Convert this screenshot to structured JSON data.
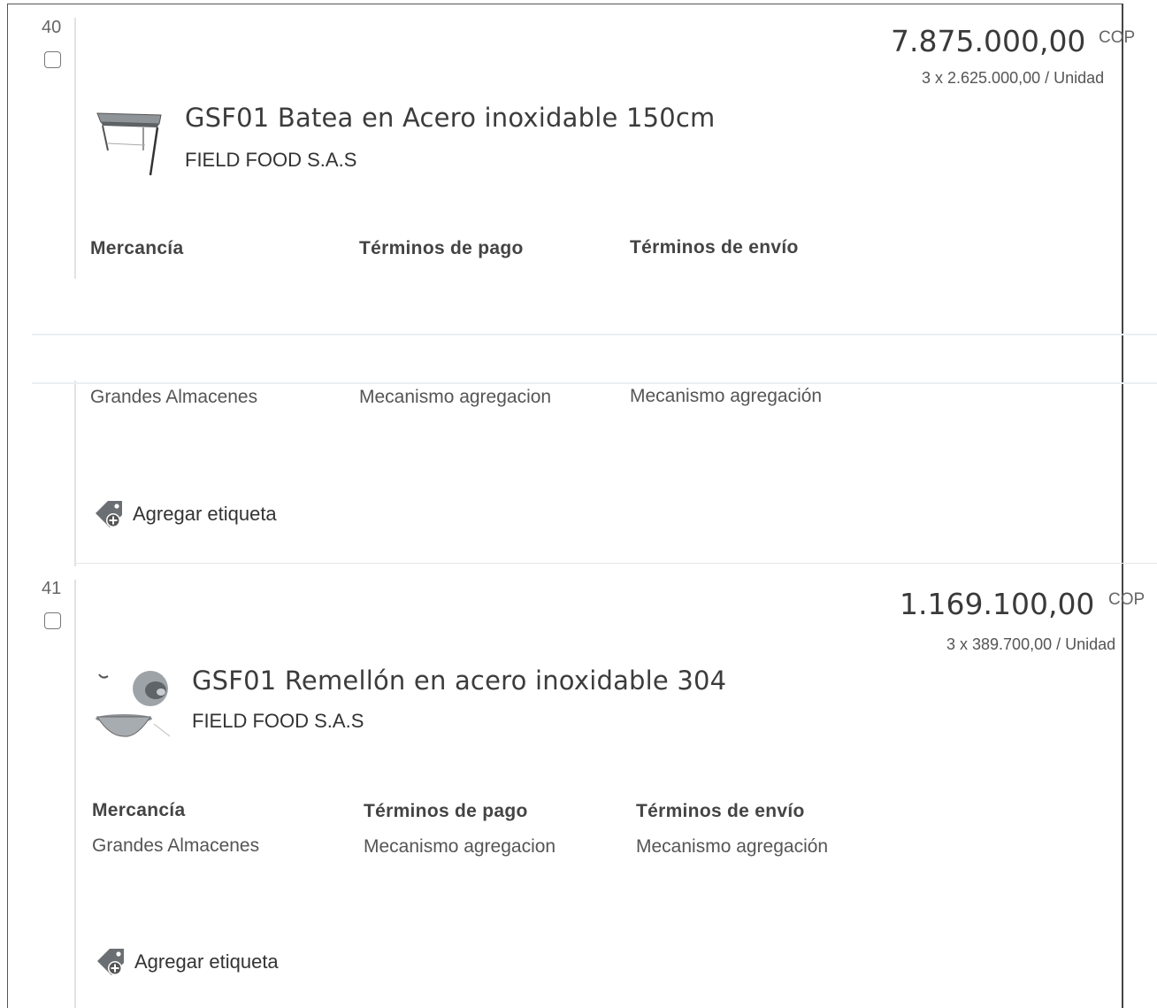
{
  "items": [
    {
      "number": "40",
      "price": "7.875.000,00",
      "currency": "COP",
      "unit_price": "3 x 2.625.000,00 / Unidad",
      "title": "GSF01 Batea en Acero inoxidable 150cm",
      "vendor": "FIELD FOOD S.A.S",
      "columns": [
        {
          "label": "Mercancía",
          "value": "Grandes Almacenes"
        },
        {
          "label": "Términos de pago",
          "value": "Mecanismo agregacion"
        },
        {
          "label": "Términos de envío",
          "value": "Mecanismo agregación"
        }
      ],
      "add_tag_label": "Agregar etiqueta"
    },
    {
      "number": "41",
      "price": "1.169.100,00",
      "currency": "COP",
      "unit_price": "3 x 389.700,00 / Unidad",
      "title": "GSF01 Remellón en acero inoxidable 304",
      "vendor": "FIELD FOOD S.A.S",
      "columns": [
        {
          "label": "Mercancía",
          "value": "Grandes Almacenes"
        },
        {
          "label": "Términos de pago",
          "value": "Mecanismo agregacion"
        },
        {
          "label": "Términos de envío",
          "value": "Mecanismo agregación"
        }
      ],
      "add_tag_label": "Agregar etiqueta"
    }
  ]
}
